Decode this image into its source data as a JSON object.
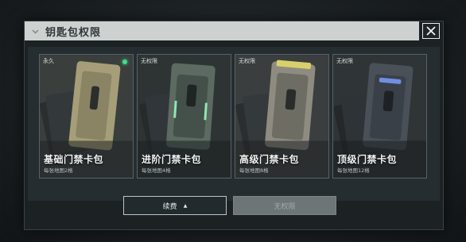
{
  "dialog": {
    "title": "钥匙包权限",
    "close_icon": "close-icon"
  },
  "cards": [
    {
      "tag": "永久",
      "name": "基础门禁卡包",
      "sub": "每张地图2格",
      "accent": "#c9c19a",
      "active": true
    },
    {
      "tag": "无权限",
      "name": "进阶门禁卡包",
      "sub": "每张地图4格",
      "accent": "#8fe8b0",
      "active": false
    },
    {
      "tag": "无权限",
      "name": "高级门禁卡包",
      "sub": "每张地图8格",
      "accent": "#d8d06a",
      "active": false
    },
    {
      "tag": "无权限",
      "name": "顶级门禁卡包",
      "sub": "每张地图12格",
      "accent": "#6f8fe0",
      "active": false
    }
  ],
  "buttons": {
    "renew": "续费",
    "no_permission": "无权限"
  },
  "colors": {
    "active_dot": "#3fe08a",
    "titlebar": "#cdd2d0"
  }
}
